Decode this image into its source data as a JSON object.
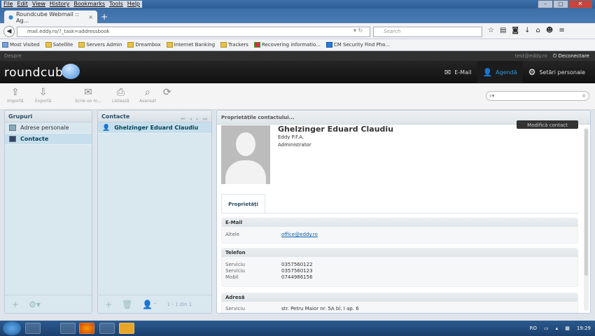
{
  "browser": {
    "menu": [
      "File",
      "Edit",
      "View",
      "History",
      "Bookmarks",
      "Tools",
      "Help"
    ],
    "tab_title": "Roundcube Webmail :: Ag...",
    "tab_close": "×",
    "new_tab": "+",
    "url": "mail.eddy.ro/?_task=addressbook",
    "search_placeholder": "Search",
    "bookmarks": [
      "Most Visited",
      "Satellite",
      "Servers Admin",
      "Dreambox",
      "Internet Banking",
      "Trackers",
      "Recovering informatio...",
      "CM Security Find Pho..."
    ]
  },
  "app": {
    "about": "Despre",
    "user_email": "test@eddy.ro",
    "logout": "Deconectare",
    "logo": "roundcube",
    "nav": [
      {
        "label": "E-Mail",
        "icon": "mail-icon"
      },
      {
        "label": "Agendă",
        "icon": "contacts-icon",
        "selected": true
      },
      {
        "label": "Setări personale",
        "icon": "gear-icon"
      }
    ]
  },
  "toolbar": {
    "import": "Importă",
    "export": "Exportă",
    "compose": "Scrie un m...",
    "print": "Listează",
    "advanced": "Avansat"
  },
  "groups": {
    "title": "Grupuri",
    "items": [
      {
        "label": "Adrese personale",
        "selected": false
      },
      {
        "label": "Contacte",
        "selected": true
      }
    ]
  },
  "contacts": {
    "title": "Contacte",
    "items": [
      {
        "label": "Ghelzinger Eduard Claudiu",
        "selected": true
      }
    ],
    "count": "1 - 1 din 1"
  },
  "detail": {
    "title": "Proprietățile contactului...",
    "name": "Ghelzinger Eduard Claudiu",
    "organization": "Eddy P.F.A.",
    "job_title": "Administrator",
    "edit_button": "Modifică contact",
    "tab": "Proprietăți",
    "email_section": "E-Mail",
    "email_label": "Altele",
    "email_value": "office@eddy.ro",
    "phone_section": "Telefon",
    "phones": [
      {
        "label": "Serviciu",
        "value": "0357560122"
      },
      {
        "label": "Serviciu",
        "value": "0357560123"
      },
      {
        "label": "Mobil",
        "value": "0744986156"
      }
    ],
    "address_section": "Adresă",
    "address_label": "Serviciu",
    "address_value": "str. Petru Maior nr. 5A bl. I ap. 6"
  },
  "taskbar": {
    "lang": "RO",
    "time": "19:29"
  }
}
